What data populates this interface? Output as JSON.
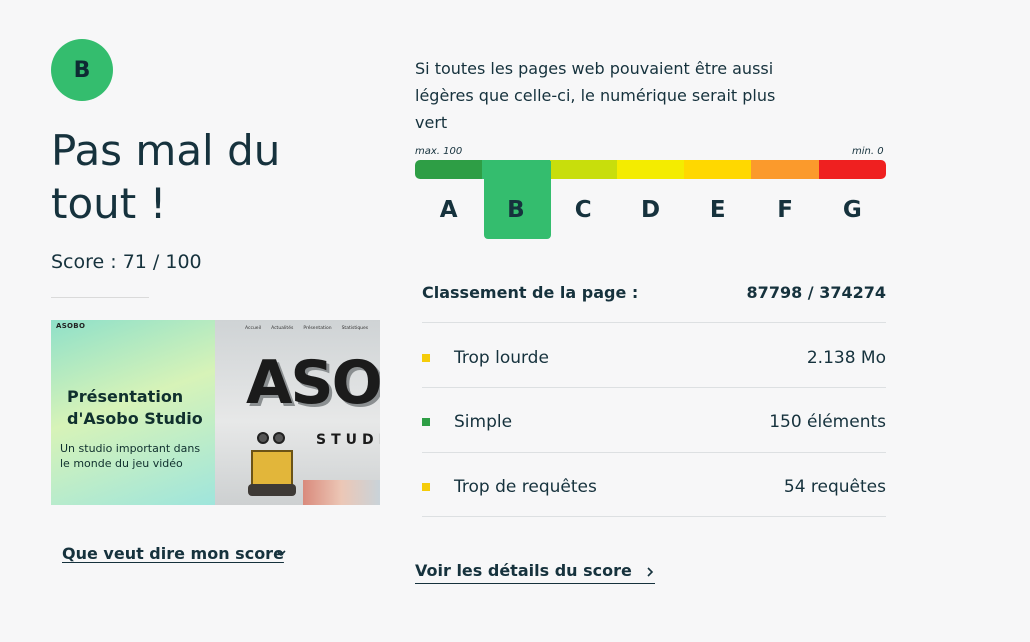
{
  "result": {
    "grade": "B",
    "headline": "Pas mal du tout !",
    "score_text": "Score : 71 / 100",
    "score": 71,
    "score_max": 100,
    "grade_color": "#34bd6e"
  },
  "thumbnail": {
    "logo": "ASOBO",
    "nav": [
      "Accueil",
      "Actualités",
      "Présentation",
      "Statistiques"
    ],
    "title": "Présentation d'Asobo Studio",
    "subtitle": "Un studio important dans le monde du jeu vidéo",
    "wall_text": "ASO",
    "wall_sub": "STUDI"
  },
  "links": {
    "score_meaning": "Que veut dire mon score",
    "score_details": "Voir les détails du score"
  },
  "intro": "Si toutes les pages web pouvaient être aussi légères que celle-ci, le numérique serait plus vert",
  "scale": {
    "max_label": "max. 100",
    "min_label": "min. 0",
    "grades": [
      {
        "letter": "A",
        "color": "#2e9e45"
      },
      {
        "letter": "B",
        "color": "#34bd6e"
      },
      {
        "letter": "C",
        "color": "#c8de0c"
      },
      {
        "letter": "D",
        "color": "#f4ec00"
      },
      {
        "letter": "E",
        "color": "#ffd800"
      },
      {
        "letter": "F",
        "color": "#fb9a2c"
      },
      {
        "letter": "G",
        "color": "#ef2020"
      }
    ],
    "selected": "B"
  },
  "ranking": {
    "label": "Classement de la page :",
    "value": "87798 / 374274"
  },
  "metrics": [
    {
      "label": "Trop lourde",
      "value": "2.138 Mo",
      "color": "#f5cc0a"
    },
    {
      "label": "Simple",
      "value": "150 éléments",
      "color": "#2e9e45"
    },
    {
      "label": "Trop de requêtes",
      "value": "54 requêtes",
      "color": "#f5cc0a"
    }
  ]
}
